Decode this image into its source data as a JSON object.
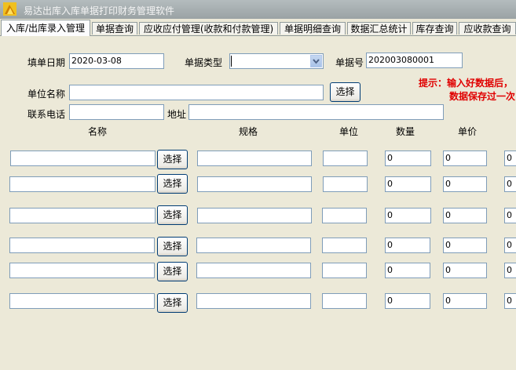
{
  "window": {
    "title": "易达出库入库单据打印财务管理软件"
  },
  "tabs": [
    {
      "label": "入库/出库录入管理"
    },
    {
      "label": "单据查询"
    },
    {
      "label": "应收应付管理(收款和付款管理)"
    },
    {
      "label": "单据明细查询"
    },
    {
      "label": "数据汇总统计"
    },
    {
      "label": "库存查询"
    },
    {
      "label": "应收款查询"
    }
  ],
  "form": {
    "date_label": "填单日期",
    "date_value": "2020-03-08",
    "type_label": "单据类型",
    "type_value": "",
    "number_label": "单据号",
    "number_value": "202003080001",
    "unit_label": "单位名称",
    "unit_value": "",
    "select_label": "选择",
    "phone_label": "联系电话",
    "phone_value": "",
    "address_label": "地址",
    "address_value": ""
  },
  "tip": {
    "line1": "提示：输入好数据后，",
    "line2": "数据保存过一次"
  },
  "columns": {
    "name": "名称",
    "spec": "规格",
    "unit": "单位",
    "qty": "数量",
    "price": "单价"
  },
  "rows": [
    {
      "name": "",
      "select_label": "选择",
      "spec": "",
      "unit": "",
      "qty": "0",
      "price": "0",
      "extra": "0"
    },
    {
      "name": "",
      "select_label": "选择",
      "spec": "",
      "unit": "",
      "qty": "0",
      "price": "0",
      "extra": "0"
    },
    {
      "name": "",
      "select_label": "选择",
      "spec": "",
      "unit": "",
      "qty": "0",
      "price": "0",
      "extra": "0"
    },
    {
      "name": "",
      "select_label": "选择",
      "spec": "",
      "unit": "",
      "qty": "0",
      "price": "0",
      "extra": "0"
    },
    {
      "name": "",
      "select_label": "选择",
      "spec": "",
      "unit": "",
      "qty": "0",
      "price": "0",
      "extra": "0"
    },
    {
      "name": "",
      "select_label": "选择",
      "spec": "",
      "unit": "",
      "qty": "0",
      "price": "0",
      "extra": "0"
    }
  ],
  "colors": {
    "tip": "#e00000",
    "field_border": "#7f9db9",
    "button_border": "#003c74",
    "background": "#ece9d8"
  },
  "icons": {
    "app": "app-logo-icon",
    "dropdown": "chevron-down-icon"
  }
}
